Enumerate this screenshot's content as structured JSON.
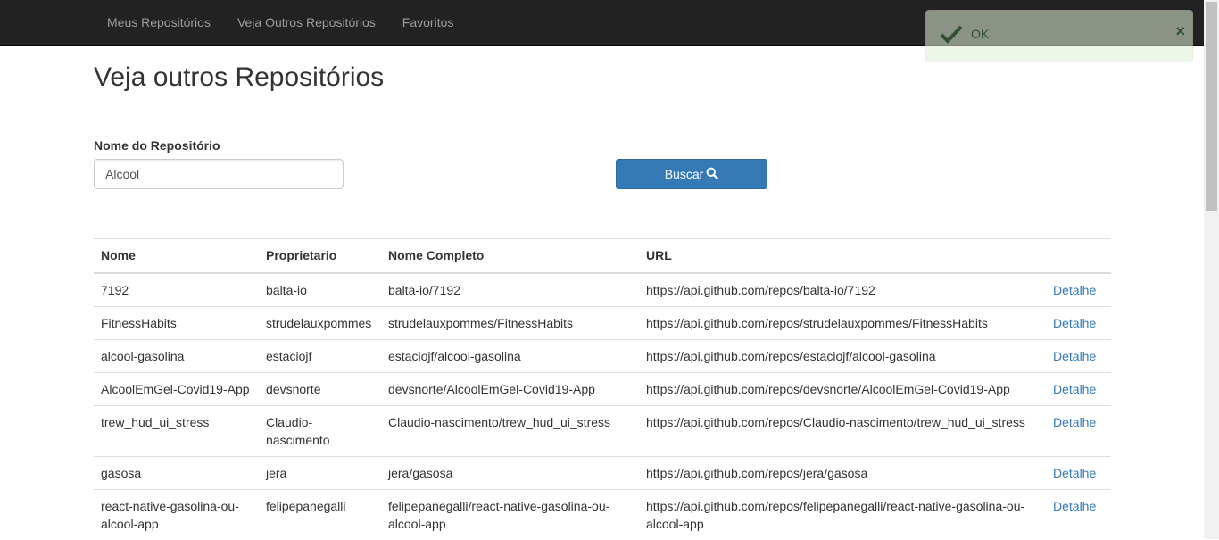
{
  "nav": {
    "items": [
      {
        "label": "Meus Repositórios"
      },
      {
        "label": "Veja Outros Repositórios"
      },
      {
        "label": "Favoritos"
      }
    ]
  },
  "toast": {
    "text": "OK",
    "close": "×"
  },
  "page": {
    "title": "Veja outros Repositórios"
  },
  "search": {
    "label": "Nome do Repositório",
    "value": "Alcool",
    "button_label": "Buscar",
    "button_icon": "search-icon"
  },
  "table": {
    "headers": {
      "nome": "Nome",
      "proprietario": "Proprietario",
      "nome_completo": "Nome Completo",
      "url": "URL",
      "acao": ""
    },
    "rows": [
      {
        "nome": "7192",
        "proprietario": "balta-io",
        "nome_completo": "balta-io/7192",
        "url": "https://api.github.com/repos/balta-io/7192",
        "link": "Detalhe"
      },
      {
        "nome": "FitnessHabits",
        "proprietario": "strudelauxpommes",
        "nome_completo": "strudelauxpommes/FitnessHabits",
        "url": "https://api.github.com/repos/strudelauxpommes/FitnessHabits",
        "link": "Detalhe"
      },
      {
        "nome": "alcool-gasolina",
        "proprietario": "estaciojf",
        "nome_completo": "estaciojf/alcool-gasolina",
        "url": "https://api.github.com/repos/estaciojf/alcool-gasolina",
        "link": "Detalhe"
      },
      {
        "nome": "AlcoolEmGel-Covid19-App",
        "proprietario": "devsnorte",
        "nome_completo": "devsnorte/AlcoolEmGel-Covid19-App",
        "url": "https://api.github.com/repos/devsnorte/AlcoolEmGel-Covid19-App",
        "link": "Detalhe"
      },
      {
        "nome": "trew_hud_ui_stress",
        "proprietario": "Claudio-nascimento",
        "nome_completo": "Claudio-nascimento/trew_hud_ui_stress",
        "url": "https://api.github.com/repos/Claudio-nascimento/trew_hud_ui_stress",
        "link": "Detalhe"
      },
      {
        "nome": "gasosa",
        "proprietario": "jera",
        "nome_completo": "jera/gasosa",
        "url": "https://api.github.com/repos/jera/gasosa",
        "link": "Detalhe"
      },
      {
        "nome": "react-native-gasolina-ou-alcool-app",
        "proprietario": "felipepanegalli",
        "nome_completo": "felipepanegalli/react-native-gasolina-ou-alcool-app",
        "url": "https://api.github.com/repos/felipepanegalli/react-native-gasolina-ou-alcool-app",
        "link": "Detalhe"
      }
    ]
  },
  "colors": {
    "navbar": "#222222",
    "nav_text": "#9d9d9d",
    "primary": "#337ab7",
    "toast_bg": "#dff0d8",
    "toast_text": "#3c763d"
  }
}
